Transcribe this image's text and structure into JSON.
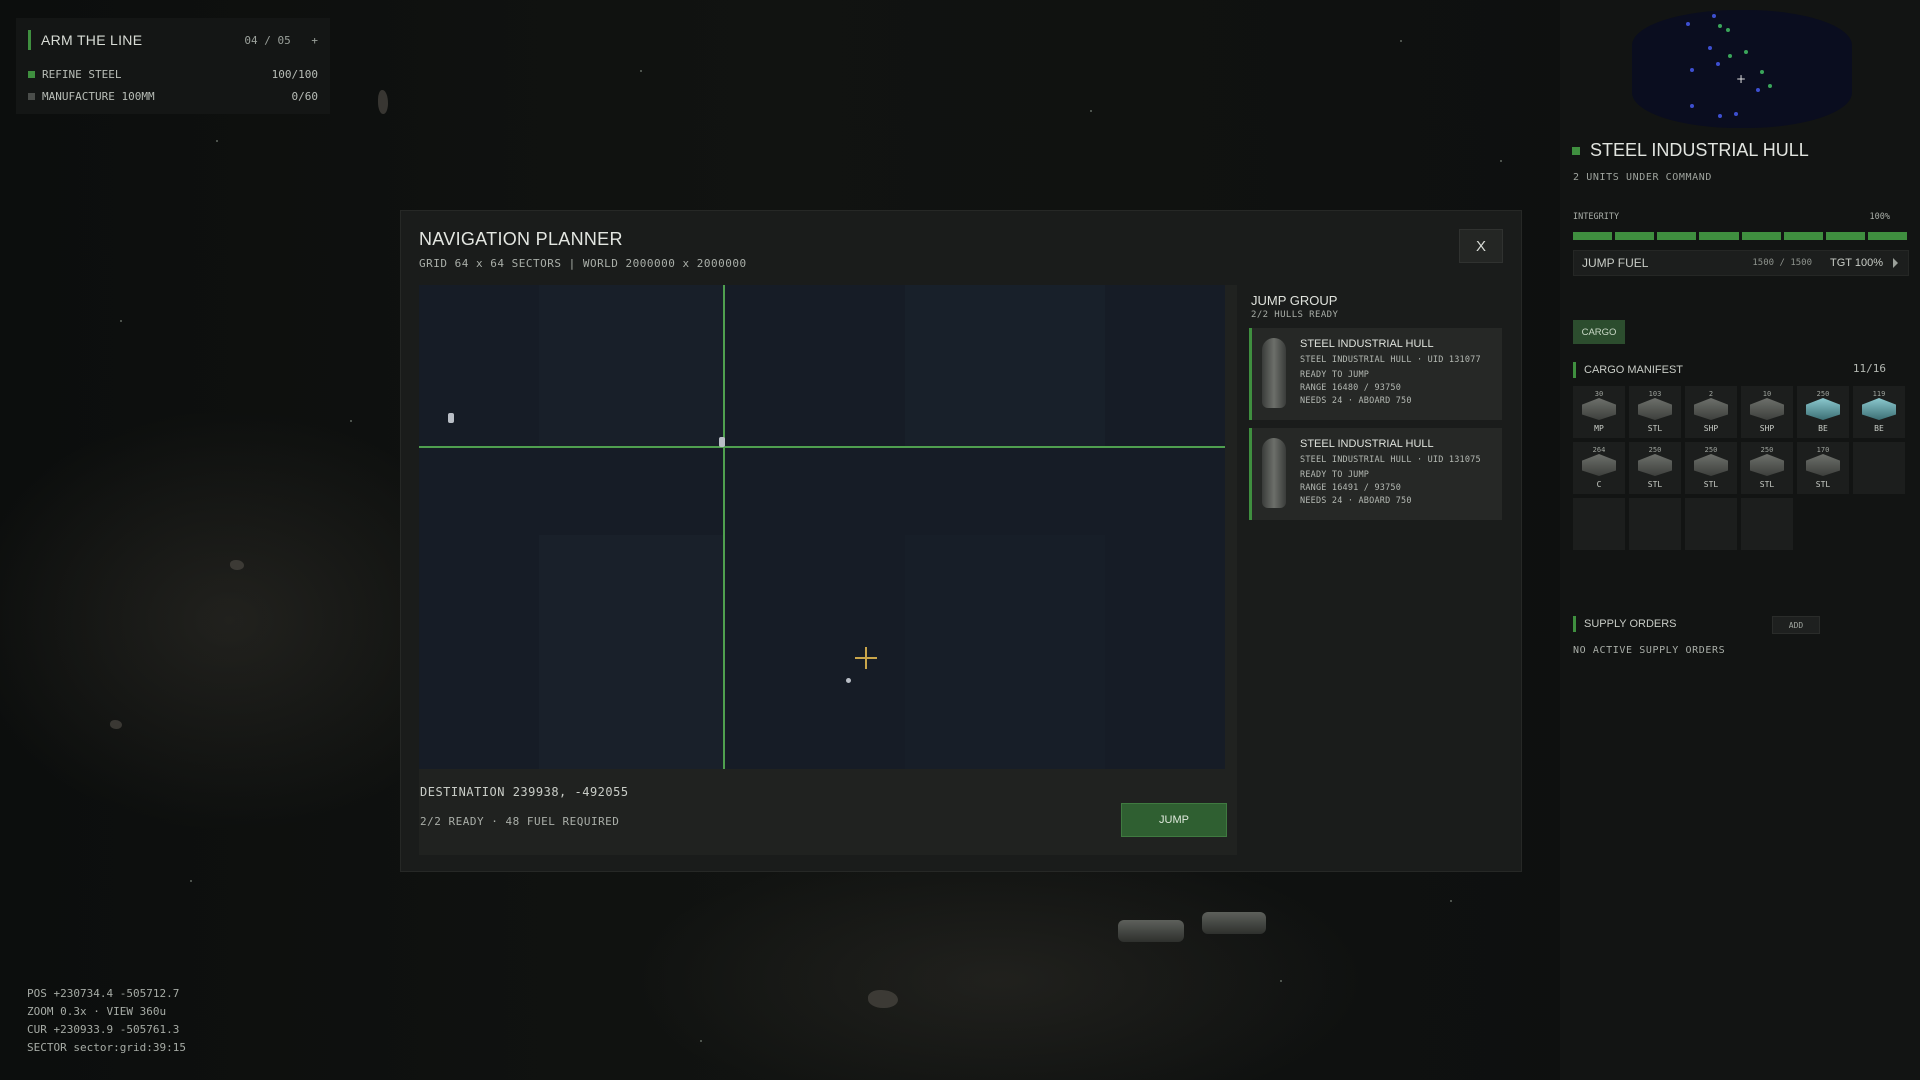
{
  "quest": {
    "title": "ARM THE LINE",
    "progress": "04 / 05",
    "expand": "+",
    "tasks": [
      {
        "label": "REFINE STEEL",
        "value": "100/100",
        "done": true
      },
      {
        "label": "MANUFACTURE 100MM",
        "value": "0/60",
        "done": false
      }
    ]
  },
  "modal": {
    "title": "NAVIGATION PLANNER",
    "subtitle": "GRID 64 x 64 SECTORS | WORLD 2000000 x 2000000",
    "close_label": "X",
    "destination": "DESTINATION 239938, -492055",
    "ready_summary": "2/2 READY · 48 FUEL REQUIRED",
    "jump_label": "JUMP"
  },
  "jump_group": {
    "title": "JUMP GROUP",
    "subtitle": "2/2 HULLS READY",
    "hulls": [
      {
        "name": "STEEL INDUSTRIAL HULL",
        "desc": "STEEL INDUSTRIAL HULL · UID 131077",
        "status": "READY TO JUMP",
        "range": "RANGE 16480 / 93750",
        "needs": "NEEDS 24 · ABOARD 750"
      },
      {
        "name": "STEEL INDUSTRIAL HULL",
        "desc": "STEEL INDUSTRIAL HULL · UID 131075",
        "status": "READY TO JUMP",
        "range": "RANGE 16491 / 93750",
        "needs": "NEEDS 24 · ABOARD 750"
      }
    ]
  },
  "side": {
    "unit_title": "STEEL INDUSTRIAL HULL",
    "unit_sub": "2 UNITS UNDER COMMAND",
    "integrity_label": "INTEGRITY",
    "integrity_value": "100%",
    "integrity_fraction": 1.0,
    "fuel_label": "JUMP FUEL",
    "fuel_value": "1500 / 1500",
    "fuel_target": "TGT 100%",
    "cargo_tab": "CARGO",
    "cargo_title": "CARGO MANIFEST",
    "cargo_count": "11/16",
    "cargo": [
      {
        "qty": "30",
        "label": "MP",
        "kind": "crate"
      },
      {
        "qty": "103",
        "label": "STL",
        "kind": "crate"
      },
      {
        "qty": "2",
        "label": "SHP",
        "kind": "crate"
      },
      {
        "qty": "10",
        "label": "SHP",
        "kind": "crate"
      },
      {
        "qty": "250",
        "label": "BE",
        "kind": "be"
      },
      {
        "qty": "119",
        "label": "BE",
        "kind": "be"
      },
      {
        "qty": "264",
        "label": "C",
        "kind": "crate"
      },
      {
        "qty": "250",
        "label": "STL",
        "kind": "crate"
      },
      {
        "qty": "250",
        "label": "STL",
        "kind": "crate"
      },
      {
        "qty": "250",
        "label": "STL",
        "kind": "crate"
      },
      {
        "qty": "170",
        "label": "STL",
        "kind": "crate"
      }
    ],
    "supply_title": "SUPPLY ORDERS",
    "add_label": "ADD",
    "no_supply": "NO ACTIVE SUPPLY ORDERS"
  },
  "debug": {
    "pos": "POS  +230734.4 -505712.7",
    "zoom": "ZOOM 0.3x · VIEW 360u",
    "cur": "CUR  +230933.9 -505761.3",
    "sector": "SECTOR sector:grid:39:15"
  },
  "colors": {
    "accent": "#3f8f3f",
    "crosshair": "#c9a54a",
    "grid_bg": "#161c26"
  }
}
